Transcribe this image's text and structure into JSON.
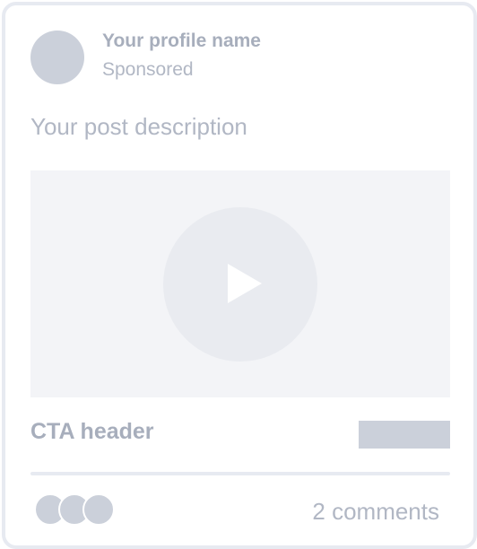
{
  "post": {
    "profile_name": "Your profile name",
    "sponsored_label": "Sponsored",
    "description": "Your post description"
  },
  "media": {
    "type": "video",
    "icon": "play-icon"
  },
  "cta": {
    "header": "CTA header"
  },
  "footer": {
    "comments": "2 comments",
    "reaction_count": 3
  },
  "colors": {
    "card_border": "#e7eaf1",
    "placeholder_dark": "#cbd0da",
    "placeholder_text": "#a7aebc",
    "placeholder_light_text": "#b1b7c4",
    "media_bg": "#f3f4f7",
    "play_circle": "#e9ebf0"
  }
}
